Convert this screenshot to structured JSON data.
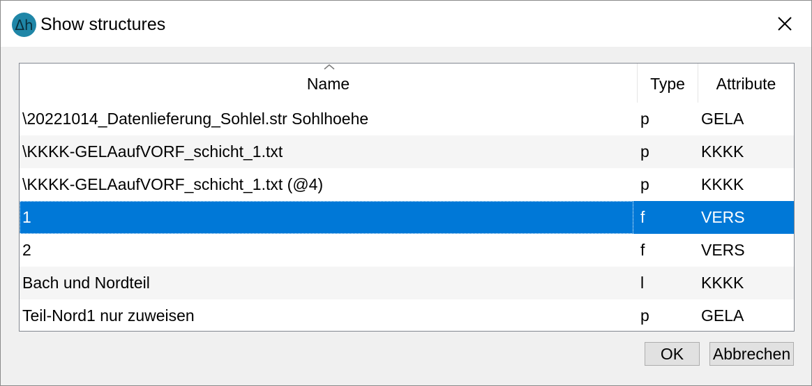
{
  "window": {
    "title": "Show structures",
    "icon": "delta-h-app-icon",
    "close_icon": "close-icon"
  },
  "table": {
    "sort_indicator": "sort-ascending-icon",
    "columns": [
      "Name",
      "Type",
      "Attribute"
    ],
    "rows": [
      {
        "name": "\\20221014_Datenlieferung_Sohlel.str Sohlhoehe",
        "type": "p",
        "attribute": "GELA"
      },
      {
        "name": "\\KKKK-GELAaufVORF_schicht_1.txt",
        "type": "p",
        "attribute": "KKKK"
      },
      {
        "name": "\\KKKK-GELAaufVORF_schicht_1.txt (@4)",
        "type": "p",
        "attribute": "KKKK"
      },
      {
        "name": "1",
        "type": "f",
        "attribute": "VERS"
      },
      {
        "name": "2",
        "type": "f",
        "attribute": "VERS"
      },
      {
        "name": "Bach und Nordteil",
        "type": "l",
        "attribute": "KKKK"
      },
      {
        "name": "Teil-Nord1 nur zuweisen",
        "type": "p",
        "attribute": "GELA"
      }
    ],
    "selected_row": 3
  },
  "buttons": {
    "ok": "OK",
    "cancel": "Abbrechen"
  },
  "colors": {
    "selection": "#0078d7",
    "app_icon": "#1f86a7"
  }
}
